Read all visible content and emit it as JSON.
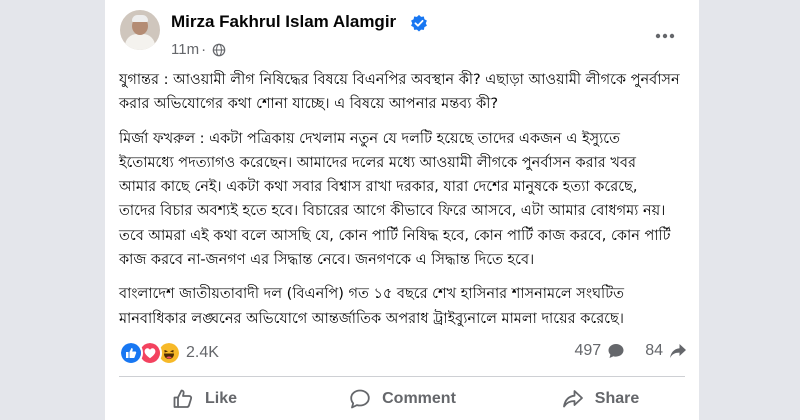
{
  "post": {
    "author": "Mirza Fakhrul Islam Alamgir",
    "time": "11m",
    "paragraphs": [
      "যুগান্তর : আওয়ামী লীগ নিষিদ্ধের বিষয়ে বিএনপির অবস্থান কী? এছাড়া আওয়ামী লীগকে পুনর্বাসন\nকরার অভিযোগের কথা শোনা যাচ্ছে। এ বিষয়ে আপনার মন্তব্য কী?",
      "মির্জা ফখরুল : একটা পত্রিকায় দেখলাম নতুন যে দলটি হয়েছে তাদের একজন এ ইস্যুতে\nইতোমধ্যে পদত্যাগও করেছেন। আমাদের দলের মধ্যে আওয়ামী লীগকে পুনর্বাসন করার খবর\nআমার কাছে নেই। একটা কথা সবার বিশ্বাস রাখা দরকার, যারা দেশের মানুষকে হত্যা করেছে,\nতাদের বিচার অবশ্যই হতে হবে। বিচারের আগে কীভাবে ফিরে আসবে, এটা আমার বোধগম্য নয়।\nতবে আমরা এই কথা বলে আসছি যে, কোন পার্টি নিষিদ্ধ হবে, কোন পার্টি কাজ করবে, কোন পার্টি\nকাজ করবে না-জনগণ এর সিদ্ধান্ত নেবে। জনগণকে এ সিদ্ধান্ত দিতে হবে।",
      "বাংলাদেশ জাতীয়তাবাদী দল (বিএনপি) গত ১৫ বছরে শেখ হাসিনার শাসনামলে সংঘটিত\nমানবাধিকার লঙ্ঘনের অভিযোগে আন্তর্জাতিক অপরাধ ট্রাইব্যুনালে মামলা দায়ের করেছে।"
    ]
  },
  "reactions": {
    "icons": [
      "like-reaction",
      "love-reaction",
      "haha-reaction"
    ],
    "count": "2.4K"
  },
  "stats": {
    "comments": "497",
    "shares": "84"
  },
  "actions": {
    "like": "Like",
    "comment": "Comment",
    "share": "Share"
  },
  "colors": {
    "accent": "#1877f2",
    "love": "#f3425f",
    "haha": "#f7b928",
    "muted": "#65676b",
    "background": "#e4e6eb"
  }
}
